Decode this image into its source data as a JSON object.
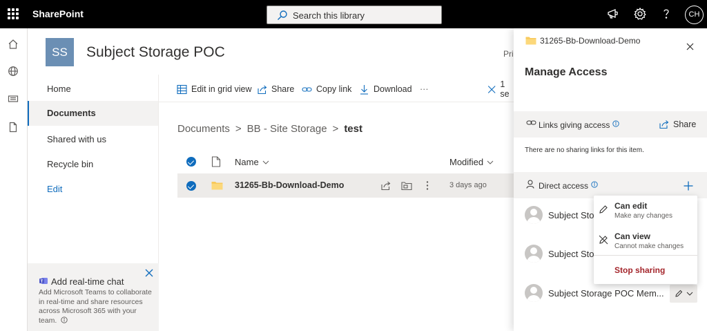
{
  "suite": {
    "app_name": "SharePoint",
    "search_placeholder": "Search this library",
    "user_initials": "CH"
  },
  "site": {
    "logo_initials": "SS",
    "title": "Subject Storage POC",
    "privacy_partial": "Pri"
  },
  "nav": {
    "items": [
      {
        "label": "Home"
      },
      {
        "label": "Documents"
      },
      {
        "label": "Shared with us"
      },
      {
        "label": "Recycle bin"
      },
      {
        "label": "Edit"
      }
    ]
  },
  "chat_card": {
    "title": "Add real-time chat",
    "body": "Add Microsoft Teams to collaborate in real-time and share resources across Microsoft 365 with your team."
  },
  "commands": {
    "edit_grid": "Edit in grid view",
    "share": "Share",
    "copy_link": "Copy link",
    "download": "Download",
    "more": "···",
    "selected": "1 se"
  },
  "breadcrumb": {
    "items": [
      "Documents",
      "BB - Site Storage",
      "test"
    ],
    "separator": ">"
  },
  "list": {
    "col_name": "Name",
    "col_modified": "Modified",
    "rows": [
      {
        "name": "31265-Bb-Download-Demo",
        "modified": "3 days ago",
        "selected": true
      }
    ]
  },
  "panel": {
    "folder_name": "31265-Bb-Download-Demo",
    "title": "Manage Access",
    "links_header": "Links giving access",
    "share_label": "Share",
    "no_links_text": "There are no sharing links for this item.",
    "direct_header": "Direct access",
    "people": [
      {
        "name": "Subject Stor"
      },
      {
        "name": "Subject Stor"
      },
      {
        "name": "Subject Storage POC Mem..."
      }
    ]
  },
  "permission_menu": {
    "can_edit": "Can edit",
    "can_edit_desc": "Make any changes",
    "can_view": "Can view",
    "can_view_desc": "Cannot make changes",
    "stop_sharing": "Stop sharing",
    "stop_color": "#a4262c"
  },
  "colors": {
    "accent": "#0f6cbd",
    "site_logo": "#6b8fb4",
    "folder": "#f8c95b"
  }
}
